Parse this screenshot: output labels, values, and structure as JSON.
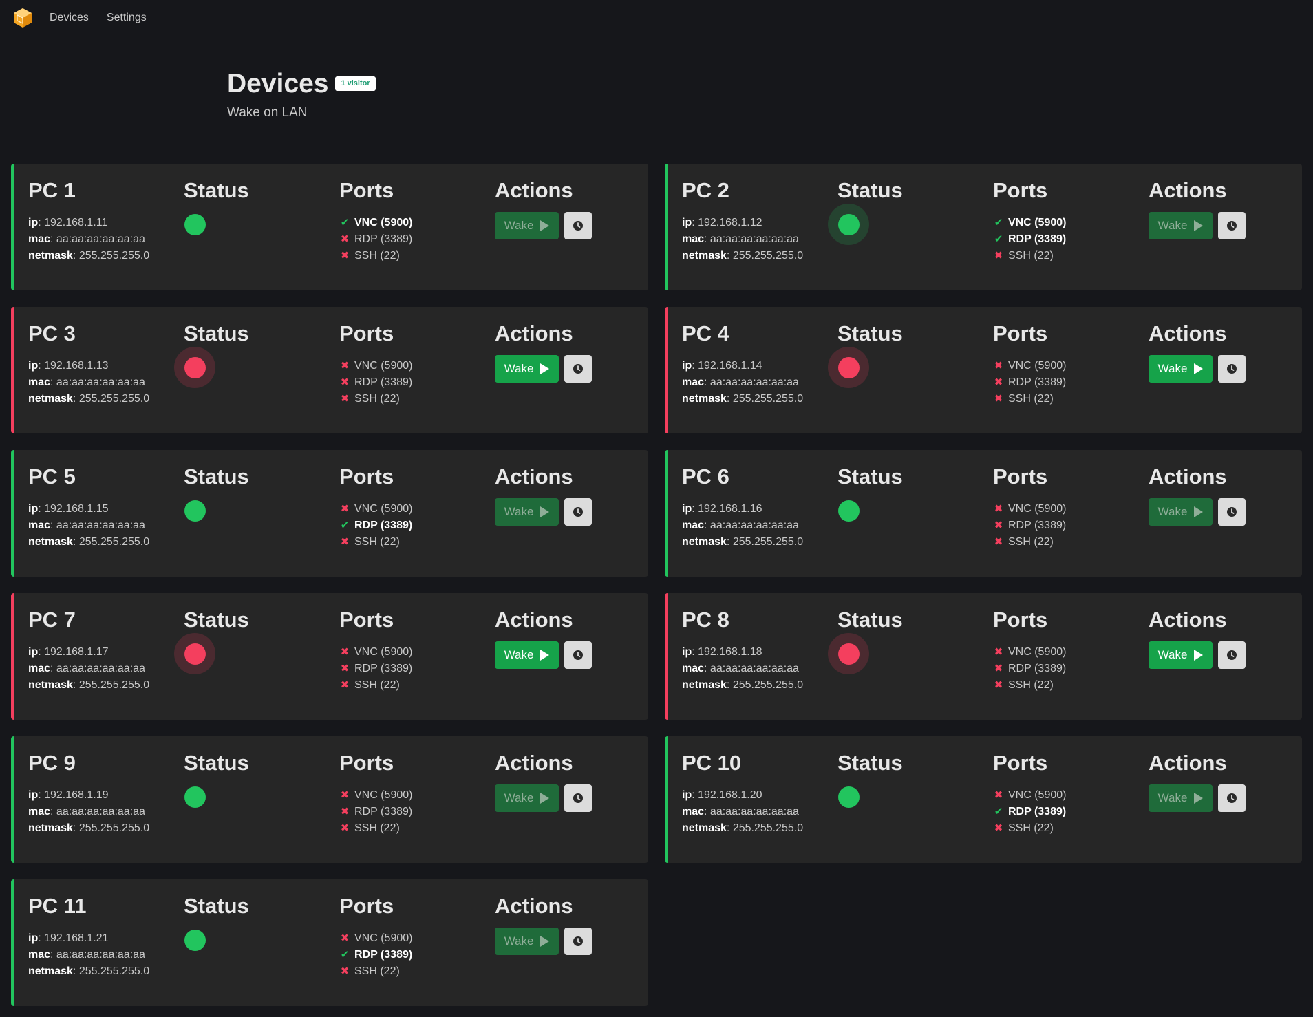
{
  "nav": {
    "logo_icon": "cube-logo-icon",
    "links": [
      "Devices",
      "Settings"
    ]
  },
  "hero": {
    "title": "Devices",
    "badge": "1 visitor",
    "subtitle": "Wake on LAN"
  },
  "labels": {
    "status": "Status",
    "ports": "Ports",
    "actions": "Actions",
    "ip": "ip",
    "mac": "mac",
    "netmask": "netmask",
    "wake": "Wake"
  },
  "colors": {
    "online": "#22c55e",
    "offline": "#f43f5e",
    "wake_enabled": "#16a34a",
    "wake_disabled": "#1f6b3a"
  },
  "devices": [
    {
      "name": "PC 1",
      "ip": "192.168.1.11",
      "mac": "aa:aa:aa:aa:aa:aa",
      "netmask": "255.255.255.0",
      "online": true,
      "halo": false,
      "ports": [
        {
          "label": "VNC (5900)",
          "open": true
        },
        {
          "label": "RDP (3389)",
          "open": false
        },
        {
          "label": "SSH (22)",
          "open": false
        }
      ]
    },
    {
      "name": "PC 2",
      "ip": "192.168.1.12",
      "mac": "aa:aa:aa:aa:aa:aa",
      "netmask": "255.255.255.0",
      "online": true,
      "halo": true,
      "ports": [
        {
          "label": "VNC (5900)",
          "open": true
        },
        {
          "label": "RDP (3389)",
          "open": true
        },
        {
          "label": "SSH (22)",
          "open": false
        }
      ]
    },
    {
      "name": "PC 3",
      "ip": "192.168.1.13",
      "mac": "aa:aa:aa:aa:aa:aa",
      "netmask": "255.255.255.0",
      "online": false,
      "halo": true,
      "ports": [
        {
          "label": "VNC (5900)",
          "open": false
        },
        {
          "label": "RDP (3389)",
          "open": false
        },
        {
          "label": "SSH (22)",
          "open": false
        }
      ]
    },
    {
      "name": "PC 4",
      "ip": "192.168.1.14",
      "mac": "aa:aa:aa:aa:aa:aa",
      "netmask": "255.255.255.0",
      "online": false,
      "halo": true,
      "ports": [
        {
          "label": "VNC (5900)",
          "open": false
        },
        {
          "label": "RDP (3389)",
          "open": false
        },
        {
          "label": "SSH (22)",
          "open": false
        }
      ]
    },
    {
      "name": "PC 5",
      "ip": "192.168.1.15",
      "mac": "aa:aa:aa:aa:aa:aa",
      "netmask": "255.255.255.0",
      "online": true,
      "halo": false,
      "ports": [
        {
          "label": "VNC (5900)",
          "open": false
        },
        {
          "label": "RDP (3389)",
          "open": true
        },
        {
          "label": "SSH (22)",
          "open": false
        }
      ]
    },
    {
      "name": "PC 6",
      "ip": "192.168.1.16",
      "mac": "aa:aa:aa:aa:aa:aa",
      "netmask": "255.255.255.0",
      "online": true,
      "halo": false,
      "ports": [
        {
          "label": "VNC (5900)",
          "open": false
        },
        {
          "label": "RDP (3389)",
          "open": false
        },
        {
          "label": "SSH (22)",
          "open": false
        }
      ]
    },
    {
      "name": "PC 7",
      "ip": "192.168.1.17",
      "mac": "aa:aa:aa:aa:aa:aa",
      "netmask": "255.255.255.0",
      "online": false,
      "halo": true,
      "ports": [
        {
          "label": "VNC (5900)",
          "open": false
        },
        {
          "label": "RDP (3389)",
          "open": false
        },
        {
          "label": "SSH (22)",
          "open": false
        }
      ]
    },
    {
      "name": "PC 8",
      "ip": "192.168.1.18",
      "mac": "aa:aa:aa:aa:aa:aa",
      "netmask": "255.255.255.0",
      "online": false,
      "halo": true,
      "ports": [
        {
          "label": "VNC (5900)",
          "open": false
        },
        {
          "label": "RDP (3389)",
          "open": false
        },
        {
          "label": "SSH (22)",
          "open": false
        }
      ]
    },
    {
      "name": "PC 9",
      "ip": "192.168.1.19",
      "mac": "aa:aa:aa:aa:aa:aa",
      "netmask": "255.255.255.0",
      "online": true,
      "halo": false,
      "ports": [
        {
          "label": "VNC (5900)",
          "open": false
        },
        {
          "label": "RDP (3389)",
          "open": false
        },
        {
          "label": "SSH (22)",
          "open": false
        }
      ]
    },
    {
      "name": "PC 10",
      "ip": "192.168.1.20",
      "mac": "aa:aa:aa:aa:aa:aa",
      "netmask": "255.255.255.0",
      "online": true,
      "halo": false,
      "ports": [
        {
          "label": "VNC (5900)",
          "open": false
        },
        {
          "label": "RDP (3389)",
          "open": true
        },
        {
          "label": "SSH (22)",
          "open": false
        }
      ]
    },
    {
      "name": "PC 11",
      "ip": "192.168.1.21",
      "mac": "aa:aa:aa:aa:aa:aa",
      "netmask": "255.255.255.0",
      "online": true,
      "halo": false,
      "ports": [
        {
          "label": "VNC (5900)",
          "open": false
        },
        {
          "label": "RDP (3389)",
          "open": true
        },
        {
          "label": "SSH (22)",
          "open": false
        }
      ]
    }
  ]
}
